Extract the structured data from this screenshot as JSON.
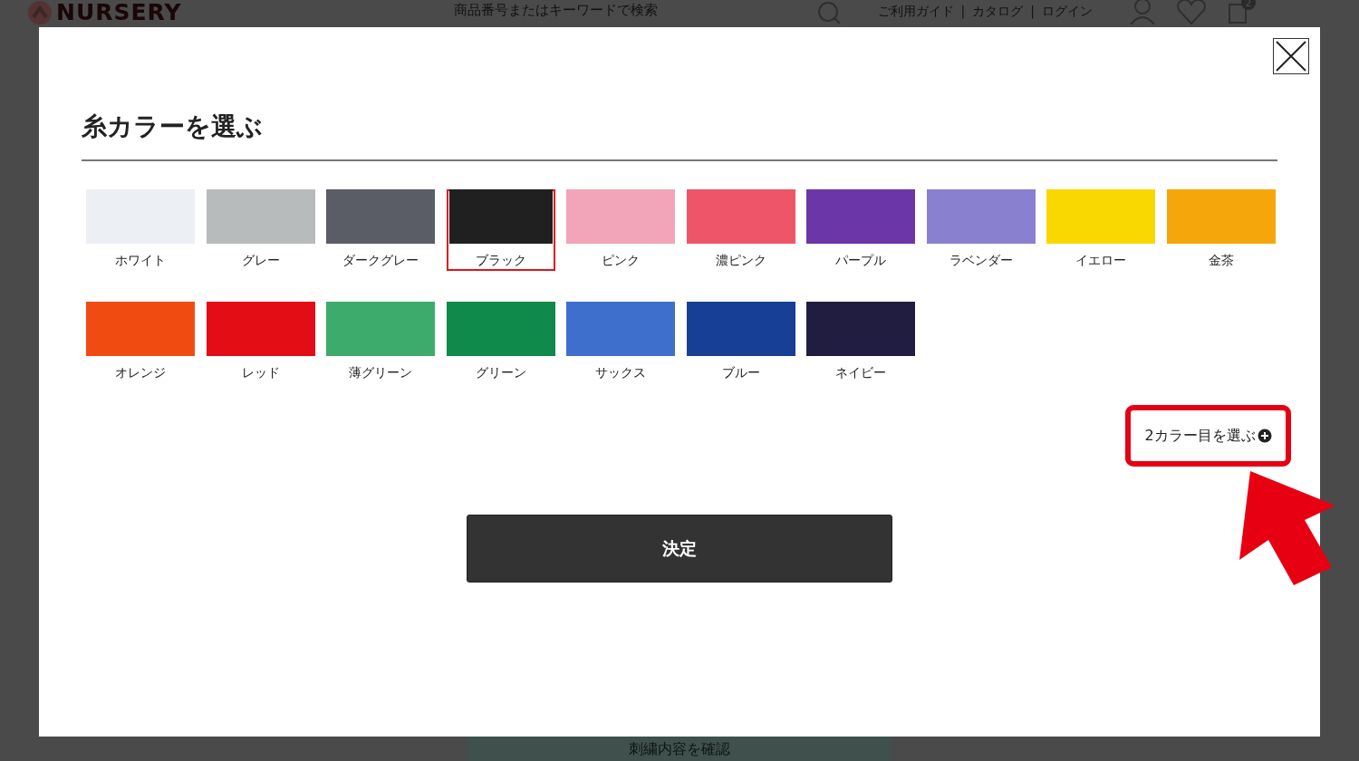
{
  "background_page": {
    "logo": "NURSERY",
    "search": {
      "placeholder": "商品番号またはキーワードで検索"
    },
    "header_links": [
      "ご利用ガイド",
      "カタログ",
      "ログイン"
    ],
    "separators": [
      "|",
      "|"
    ],
    "cart_count": "2",
    "confirm_button": "刺繍内容を確認"
  },
  "modal": {
    "title": "糸カラーを選ぶ",
    "colors": [
      {
        "label": "ホワイト",
        "color": "#eceff3",
        "selected": false
      },
      {
        "label": "グレー",
        "color": "#b8bbbb",
        "selected": false
      },
      {
        "label": "ダークグレー",
        "color": "#5b5d66",
        "selected": false
      },
      {
        "label": "ブラック",
        "color": "#1f201f",
        "selected": true
      },
      {
        "label": "ピンク",
        "color": "#f2a4b8",
        "selected": false
      },
      {
        "label": "濃ピンク",
        "color": "#ee5568",
        "selected": false
      },
      {
        "label": "パープル",
        "color": "#6a36a8",
        "selected": false
      },
      {
        "label": "ラベンダー",
        "color": "#8a80d0",
        "selected": false
      },
      {
        "label": "イエロー",
        "color": "#f8d800",
        "selected": false
      },
      {
        "label": "金茶",
        "color": "#f5a60a",
        "selected": false
      },
      {
        "label": "オレンジ",
        "color": "#f04c12",
        "selected": false
      },
      {
        "label": "レッド",
        "color": "#e20d15",
        "selected": false
      },
      {
        "label": "薄グリーン",
        "color": "#3cab6c",
        "selected": false
      },
      {
        "label": "グリーン",
        "color": "#0f8a4b",
        "selected": false
      },
      {
        "label": "サックス",
        "color": "#3f6fcc",
        "selected": false
      },
      {
        "label": "ブルー",
        "color": "#183f96",
        "selected": false
      },
      {
        "label": "ネイビー",
        "color": "#211d40",
        "selected": false
      }
    ],
    "second_color_button": "2カラー目を選ぶ",
    "submit_button": "決定"
  }
}
